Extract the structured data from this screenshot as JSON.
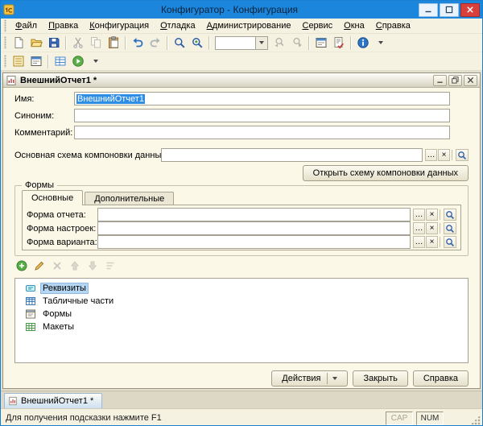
{
  "titlebar": {
    "title": "Конфигуратор - Конфигурация"
  },
  "menu": {
    "items": [
      "Файл",
      "Правка",
      "Конфигурация",
      "Отладка",
      "Администрирование",
      "Сервис",
      "Окна",
      "Справка"
    ]
  },
  "icons": {
    "window": [
      "minimize",
      "maximize",
      "close"
    ],
    "toolbar_main": [
      "new-document",
      "open",
      "save",
      "cut",
      "copy",
      "paste",
      "undo",
      "redo",
      "find",
      "find-options",
      "search-combobox",
      "find-previous",
      "find-next",
      "configuration-window",
      "syntax-check",
      "help-info",
      "toolbar-options"
    ],
    "toolbar_config": [
      "open-configuration",
      "configuration-window",
      "database-grid",
      "start-debugging",
      "toolbar-options"
    ],
    "mini_toolbar": [
      "add",
      "edit",
      "delete",
      "move-up",
      "move-down",
      "sort"
    ],
    "tree": [
      "attribute",
      "tabular-section",
      "form",
      "template"
    ],
    "field": [
      "ellipsis",
      "clear",
      "open-magnifier"
    ]
  },
  "toolbar": {
    "search_combo_value": ""
  },
  "doc": {
    "title": "ВнешнийОтчет1 *",
    "name_label": "Имя:",
    "name_value": "ВнешнийОтчет1",
    "synonym_label": "Синоним:",
    "synonym_value": "",
    "comment_label": "Комментарий:",
    "comment_value": "",
    "schema_label": "Основная схема компоновки данных:",
    "schema_value": "",
    "open_schema_button": "Открыть схему компоновки данных",
    "field_buttons": {
      "ellipsis": "…",
      "clear": "×"
    },
    "forms": {
      "legend": "Формы",
      "tabs": [
        "Основные",
        "Дополнительные"
      ],
      "rows": [
        {
          "label": "Форма отчета:",
          "value": ""
        },
        {
          "label": "Форма настроек:",
          "value": ""
        },
        {
          "label": "Форма варианта:",
          "value": ""
        }
      ]
    },
    "tree": {
      "items": [
        "Реквизиты",
        "Табличные части",
        "Формы",
        "Макеты"
      ],
      "selected": "Реквизиты"
    },
    "buttons": {
      "actions": "Действия",
      "close": "Закрыть",
      "help": "Справка"
    }
  },
  "taskbar": {
    "active_tab": "ВнешнийОтчет1 *"
  },
  "statusbar": {
    "hint": "Для получения подсказки нажмите F1",
    "cap": "CAP",
    "num": "NUM"
  },
  "colors": {
    "titlebar": "#1C86DC",
    "chrome_bg": "#F6F2E2",
    "content_bg": "#FBF8E8",
    "selection": "#2E8DE5",
    "tree_selection": "#B5D6F2"
  }
}
